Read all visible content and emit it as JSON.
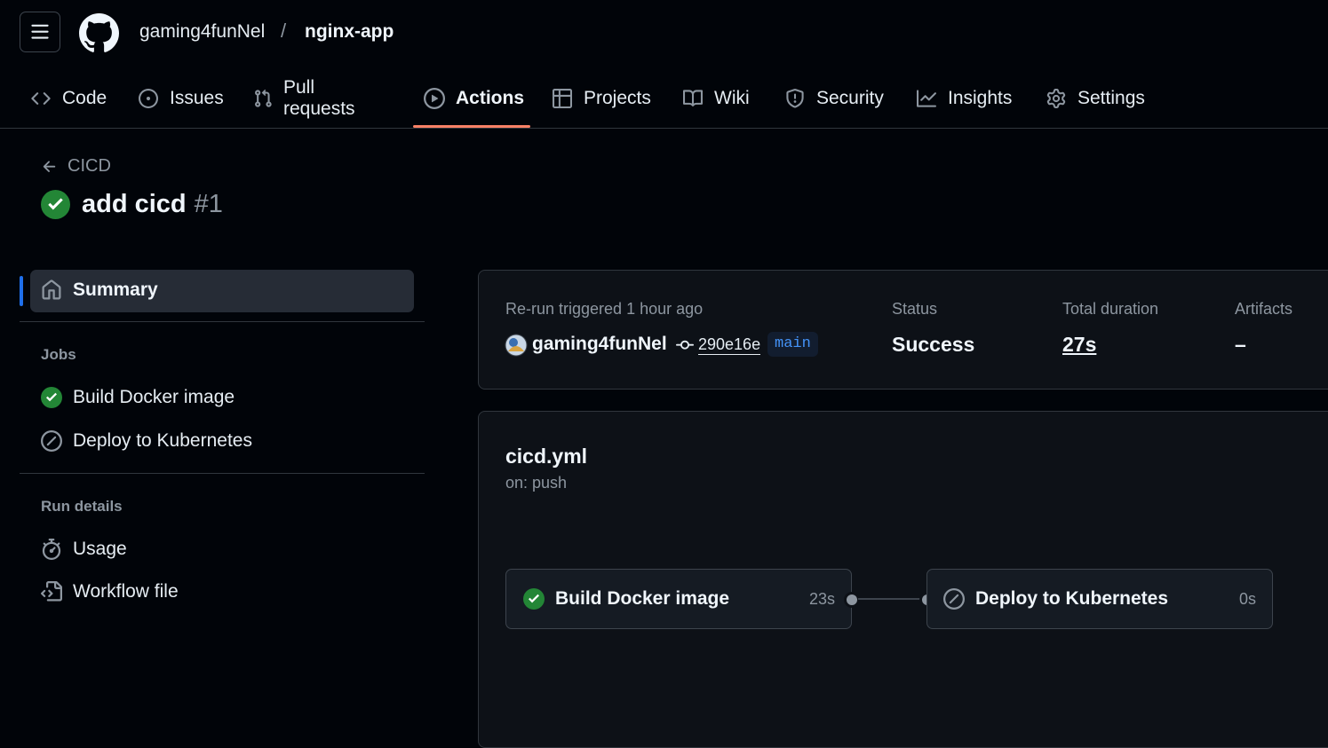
{
  "header": {
    "owner": "gaming4funNel",
    "separator": "/",
    "repo": "nginx-app"
  },
  "tabs": [
    {
      "label": "Code",
      "icon": "code-icon"
    },
    {
      "label": "Issues",
      "icon": "issue-opened-icon"
    },
    {
      "label": "Pull requests",
      "icon": "git-pull-request-icon"
    },
    {
      "label": "Actions",
      "icon": "play-icon",
      "active": true
    },
    {
      "label": "Projects",
      "icon": "table-icon"
    },
    {
      "label": "Wiki",
      "icon": "book-icon"
    },
    {
      "label": "Security",
      "icon": "shield-icon"
    },
    {
      "label": "Insights",
      "icon": "graph-icon"
    },
    {
      "label": "Settings",
      "icon": "gear-icon"
    }
  ],
  "run": {
    "back_label": "CICD",
    "title": "add cicd",
    "number": "#1"
  },
  "sidebar": {
    "summary_label": "Summary",
    "jobs_heading": "Jobs",
    "jobs": [
      {
        "label": "Build Docker image",
        "status": "success"
      },
      {
        "label": "Deploy to Kubernetes",
        "status": "skipped"
      }
    ],
    "run_details_heading": "Run details",
    "details": [
      {
        "label": "Usage",
        "icon": "stopwatch-icon"
      },
      {
        "label": "Workflow file",
        "icon": "file-code-icon"
      }
    ]
  },
  "summary": {
    "trigger_text": "Re-run triggered 1 hour ago",
    "actor": "gaming4funNel",
    "commit_sha": "290e16e",
    "branch": "main",
    "status_label": "Status",
    "status_value": "Success",
    "duration_label": "Total duration",
    "duration_value": "27s",
    "artifacts_label": "Artifacts",
    "artifacts_value": "–"
  },
  "workflow": {
    "file": "cicd.yml",
    "trigger": "on: push",
    "jobs": [
      {
        "label": "Build Docker image",
        "time": "23s",
        "status": "success"
      },
      {
        "label": "Deploy to Kubernetes",
        "time": "0s",
        "status": "skipped"
      }
    ]
  },
  "colors": {
    "background": "#010409",
    "success": "#238636",
    "accent_underline": "#f78166",
    "selected_bar": "#1f6feb",
    "branch_text": "#4493f8"
  }
}
